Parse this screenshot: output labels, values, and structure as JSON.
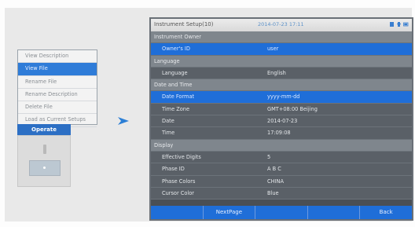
{
  "context_menu": {
    "items": [
      {
        "label": "View Description",
        "selected": false
      },
      {
        "label": "View File",
        "selected": true
      },
      {
        "label": "Rename File",
        "selected": false
      },
      {
        "label": "Rename Description",
        "selected": false
      },
      {
        "label": "Delete File",
        "selected": false
      },
      {
        "label": "Load as Current Setups",
        "selected": false
      }
    ],
    "operate_label": "Operate"
  },
  "window": {
    "title": "Instrument Setup(10)",
    "datetime": "2014-07-23 17:11",
    "status_icons": [
      "sd-card-icon",
      "usb-icon",
      "battery-icon"
    ],
    "sections": [
      {
        "title": "Instrument Owner",
        "rows": [
          {
            "label": "Owner's ID",
            "value": "user",
            "highlighted": true
          }
        ]
      },
      {
        "title": "Language",
        "rows": [
          {
            "label": "Language",
            "value": "English",
            "highlighted": false
          }
        ]
      },
      {
        "title": "Date and Time",
        "rows": [
          {
            "label": "Date Format",
            "value": "yyyy-mm-dd",
            "highlighted": true
          },
          {
            "label": "Time Zone",
            "value": "GMT+08:00 Beijing",
            "highlighted": false
          },
          {
            "label": "Date",
            "value": "2014-07-23",
            "highlighted": false
          },
          {
            "label": "Time",
            "value": "17:09:08",
            "highlighted": false
          }
        ]
      },
      {
        "title": "Display",
        "rows": [
          {
            "label": "Effective Digits",
            "value": "5",
            "highlighted": false
          },
          {
            "label": "Phase ID",
            "value": "A B C",
            "highlighted": false
          },
          {
            "label": "Phase Colors",
            "value": "CHINA",
            "highlighted": false
          },
          {
            "label": "Cursor Color",
            "value": "Blue",
            "highlighted": false
          }
        ]
      }
    ],
    "bottom_buttons": [
      "",
      "NextPage",
      "",
      "",
      "Back"
    ]
  },
  "colors": {
    "accent": "#1f6ed8",
    "section_bg": "#7f868d",
    "row_bg": "#5a6067"
  }
}
